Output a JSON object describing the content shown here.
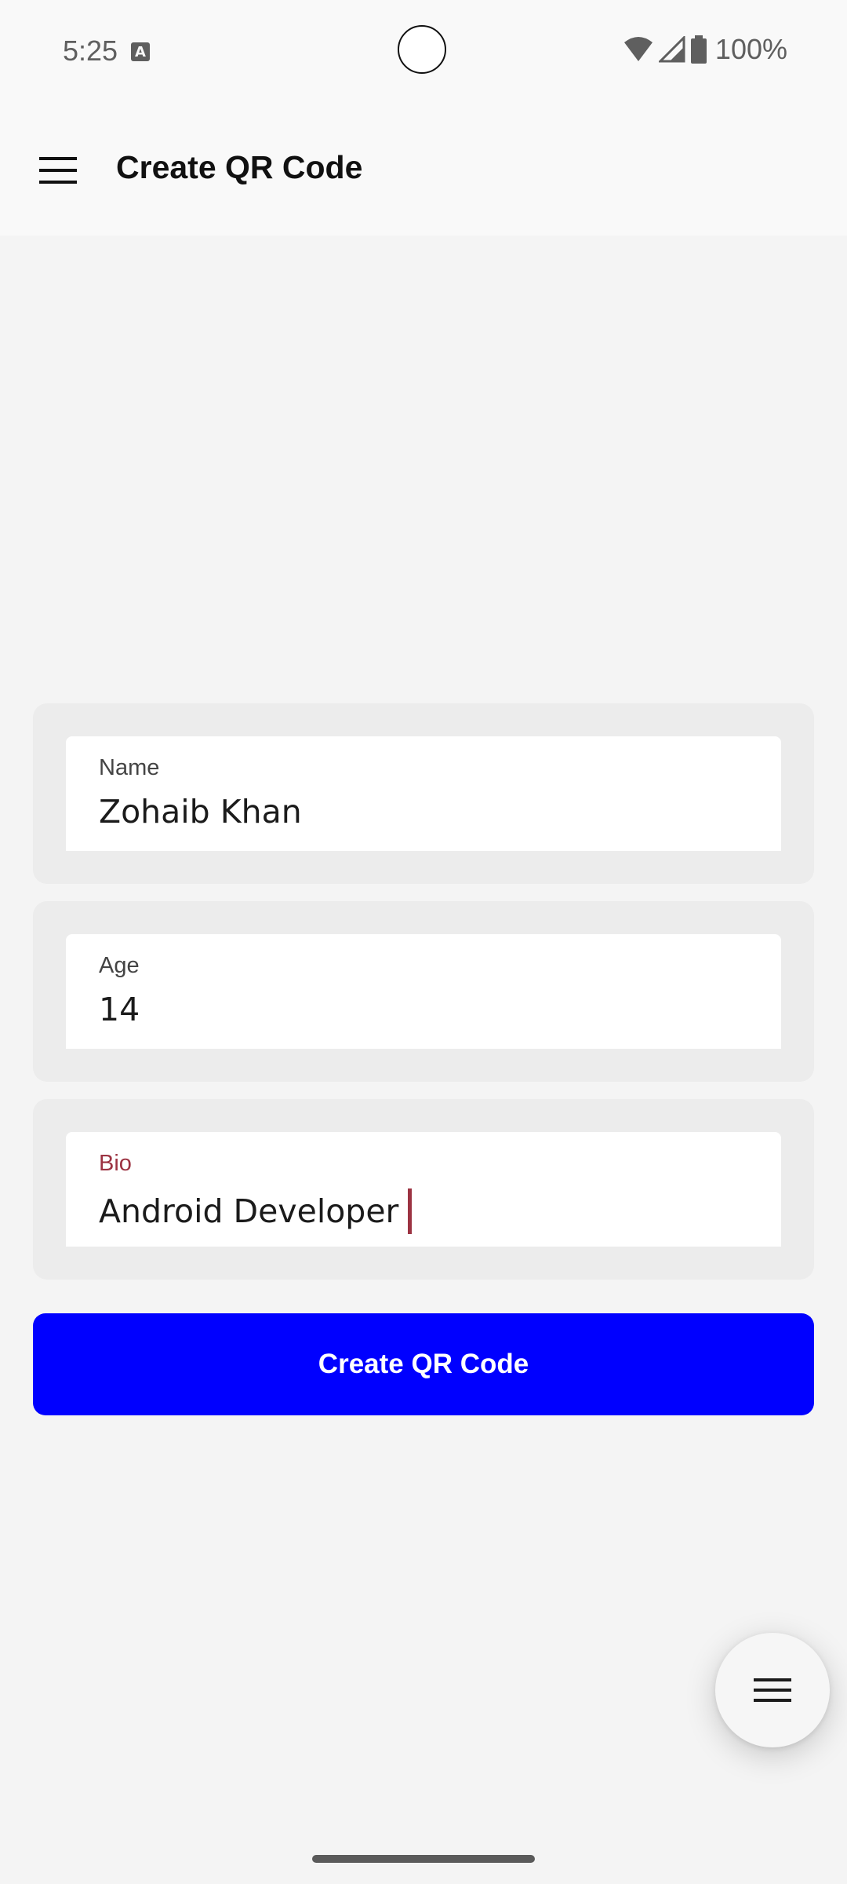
{
  "status_bar": {
    "time": "5:25",
    "notification_icon": "a-text-icon",
    "battery_text": "100%",
    "icons": [
      "wifi-icon",
      "cell-signal-icon",
      "battery-icon"
    ]
  },
  "app_bar": {
    "title": "Create QR Code",
    "menu_icon": "hamburger-menu-icon"
  },
  "form": {
    "fields": [
      {
        "label": "Name",
        "value": "Zohaib Khan",
        "focused": false
      },
      {
        "label": "Age",
        "value": "14",
        "focused": false
      },
      {
        "label": "Bio",
        "value": "Android Developer",
        "focused": true
      }
    ]
  },
  "actions": {
    "create_label": "Create QR Code"
  },
  "fab": {
    "icon": "hamburger-menu-icon"
  },
  "colors": {
    "primary_button": "#0000ff",
    "focused_label": "#9c3342",
    "background": "#f4f4f4",
    "card": "#ececec"
  }
}
